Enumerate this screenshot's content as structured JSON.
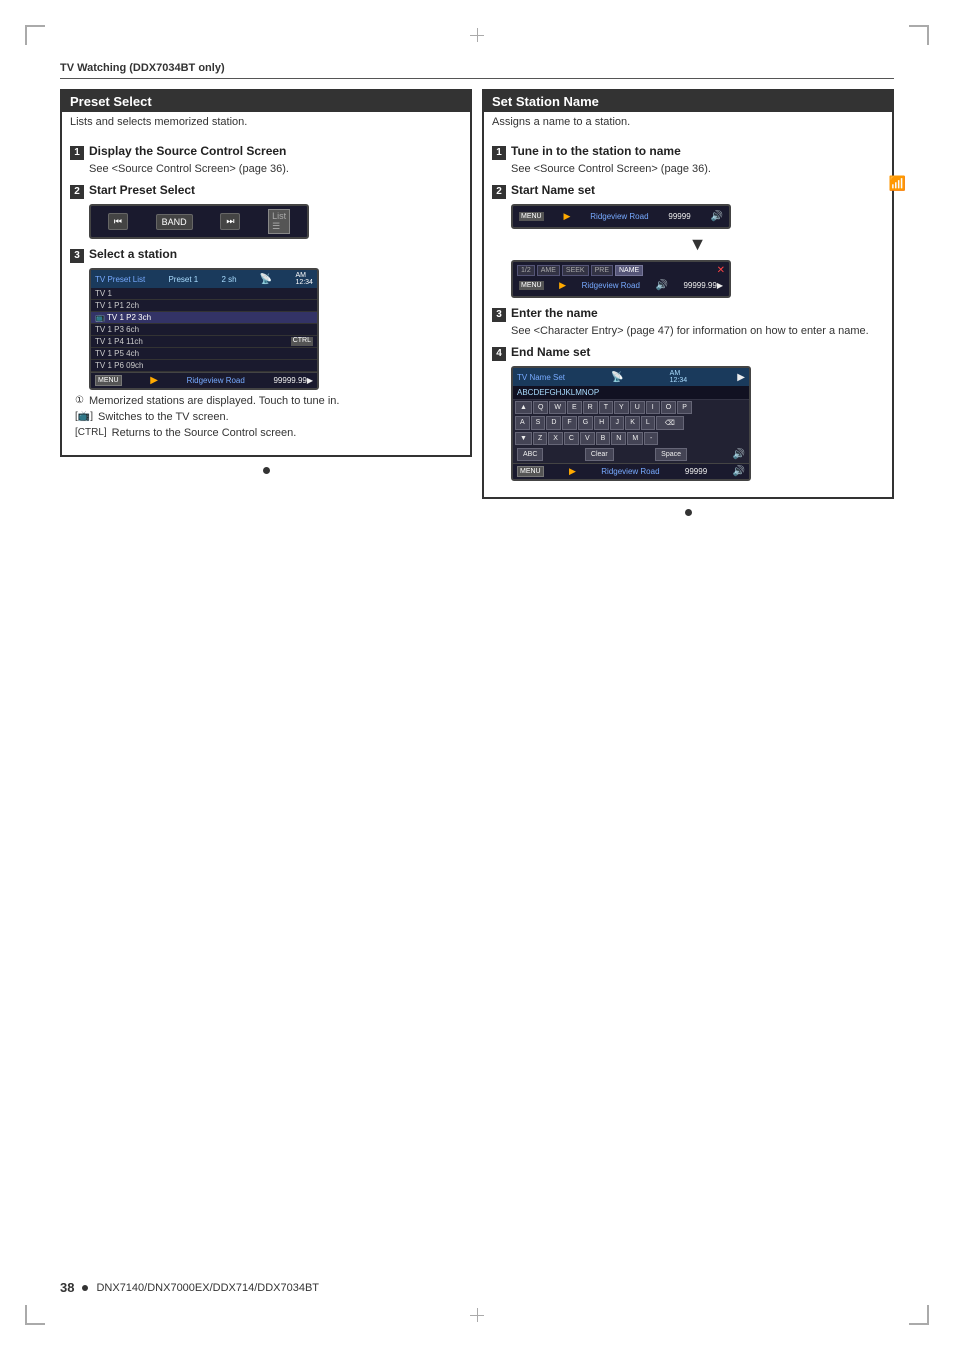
{
  "page": {
    "title": "TV Watching (DDX7034BT only)",
    "footer_num": "38",
    "footer_bullet": "●",
    "footer_text": "DNX7140/DNX7000EX/DDX714/DDX7034BT"
  },
  "left_section": {
    "title": "Preset Select",
    "intro": "Lists and selects memorized station.",
    "steps": [
      {
        "num": "1",
        "title": "Display the Source Control Screen",
        "desc": "See <Source Control Screen> (page 36)."
      },
      {
        "num": "2",
        "title": "Start Preset Select"
      },
      {
        "num": "3",
        "title": "Select a station"
      }
    ],
    "preset_buttons": [
      "⏮",
      "BAND",
      "⏭"
    ],
    "list_label": "List",
    "tv_list": {
      "header_left": "TV Preset List",
      "header_right": "Preset 1",
      "header_time": "2 sh",
      "rows": [
        {
          "label": "TV 1",
          "ch": ""
        },
        {
          "label": "TV 1 P1 2ch",
          "ch": ""
        },
        {
          "label": "TV 1 P2 3ch",
          "ch": "",
          "selected": true
        },
        {
          "label": "TV 1 P3 6ch",
          "ch": ""
        },
        {
          "label": "TV 1 P4 11ch",
          "ch": ""
        },
        {
          "label": "TV 1 P5 4ch",
          "ch": ""
        },
        {
          "label": "TV 1 P6 09ch",
          "ch": ""
        }
      ],
      "footer_road": "Ridgeview Road",
      "footer_freq": "99999.99"
    },
    "notes": [
      {
        "text": "Memorized stations are displayed. Touch to tune in."
      },
      {
        "bracket": "📺",
        "text": "Switches to the TV screen."
      },
      {
        "bracket": "[CTRL]",
        "text": "Returns to the Source Control screen."
      }
    ]
  },
  "right_section": {
    "title": "Set Station Name",
    "intro": "Assigns a name to a station.",
    "steps": [
      {
        "num": "1",
        "title": "Tune in to the station to name",
        "desc": "See <Source Control Screen> (page 36)."
      },
      {
        "num": "2",
        "title": "Start Name set",
        "screen1": {
          "road": "Ridgeview Road",
          "freq": "99999"
        },
        "screen2": {
          "tabs": [
            "1/2",
            "AME",
            "SEEK",
            "PRE",
            "NAME"
          ],
          "road": "Ridgeview Road",
          "freq": "99999.99"
        }
      },
      {
        "num": "3",
        "title": "Enter the name",
        "desc": "See <Character Entry> (page 47) for information on how to enter a name."
      },
      {
        "num": "4",
        "title": "End Name set",
        "keyboard": {
          "header": "TV Name Set",
          "text_row": "ABCDEFGHJKLMNOP",
          "rows": [
            [
              "Q",
              "W",
              "E",
              "R",
              "T",
              "Y",
              "U",
              "I",
              "O",
              "P"
            ],
            [
              "A",
              "S",
              "D",
              "F",
              "G",
              "H",
              "J",
              "K",
              "L"
            ],
            [
              "Z",
              "X",
              "C",
              "V",
              "B",
              "N",
              "M",
              "-"
            ]
          ],
          "footer_btns": [
            "ABC",
            "Clear",
            "Space"
          ],
          "road": "Ridgeview Road",
          "freq": "99999"
        }
      }
    ]
  }
}
